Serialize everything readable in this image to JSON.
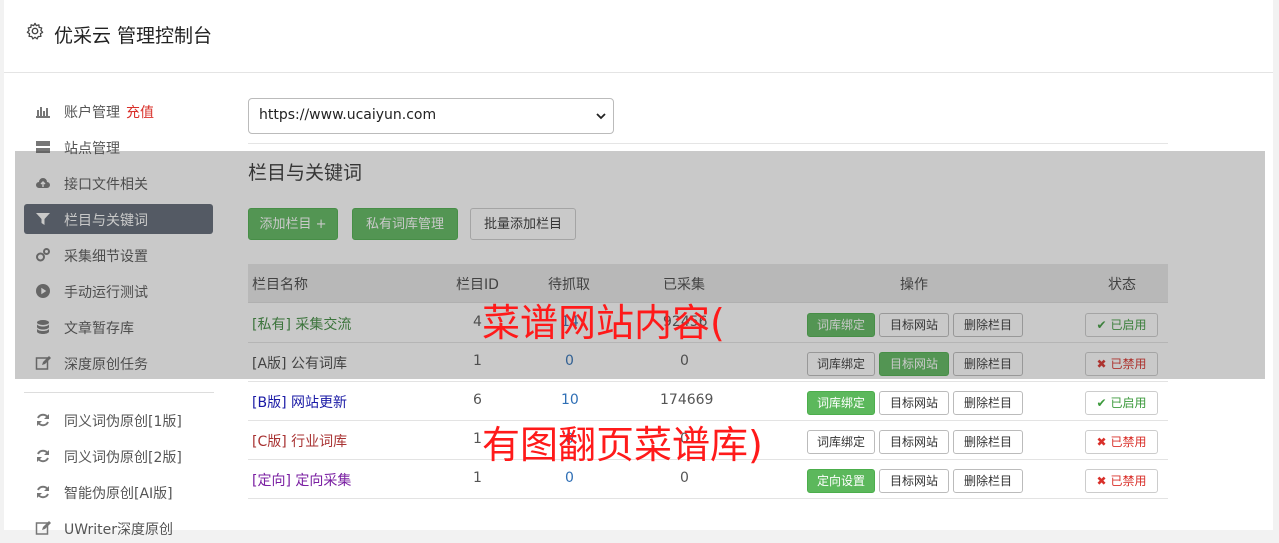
{
  "header": {
    "title": "优采云 管理控制台"
  },
  "sidebar": {
    "items": [
      {
        "label": "账户管理",
        "extra": "充值",
        "icon": "bar-chart-icon"
      },
      {
        "label": "站点管理",
        "icon": "server-icon"
      },
      {
        "label": "接口文件相关",
        "icon": "cloud-upload-icon"
      },
      {
        "label": "栏目与关键词",
        "icon": "filter-icon",
        "active": true
      },
      {
        "label": "采集细节设置",
        "icon": "gears-icon"
      },
      {
        "label": "手动运行测试",
        "icon": "play-circle-icon"
      },
      {
        "label": "文章暂存库",
        "icon": "database-icon"
      },
      {
        "label": "深度原创任务",
        "icon": "edit-icon"
      },
      {
        "label": "同义词伪原创[1版]",
        "icon": "refresh-icon"
      },
      {
        "label": "同义词伪原创[2版]",
        "icon": "refresh-icon"
      },
      {
        "label": "智能伪原创[AI版]",
        "icon": "refresh-icon"
      },
      {
        "label": "UWriter深度原创",
        "icon": "edit-icon"
      }
    ]
  },
  "site_select": {
    "value": "https://www.ucaiyun.com"
  },
  "section": {
    "title": "栏目与关键词"
  },
  "toolbar": {
    "add_column": "添加栏目 +",
    "private_lexicon": "私有词库管理",
    "batch_add": "批量添加栏目"
  },
  "table": {
    "headers": {
      "name": "栏目名称",
      "id": "栏目ID",
      "pending": "待抓取",
      "collected": "已采集",
      "ops": "操作",
      "status": "状态"
    },
    "rows": [
      {
        "tag": "[私有]",
        "name": "采集交流",
        "id": "4",
        "pending": "14",
        "collected": "92456",
        "op1": "词库绑定",
        "op2": "目标网站",
        "op3": "删除栏目",
        "status": "已启用",
        "color": "#3c8a3c"
      },
      {
        "tag": "[A版]",
        "name": "公有词库",
        "id": "1",
        "pending": "0",
        "collected": "0",
        "op1": "词库绑定",
        "op2": "目标网站",
        "op3": "删除栏目",
        "status": "已禁用",
        "color": "#444444"
      },
      {
        "tag": "[B版]",
        "name": "网站更新",
        "id": "6",
        "pending": "10",
        "collected": "174669",
        "op1": "词库绑定",
        "op2": "目标网站",
        "op3": "删除栏目",
        "status": "已启用",
        "color": "#1a1aa6"
      },
      {
        "tag": "[C版]",
        "name": "行业词库",
        "id": "1",
        "pending": "0",
        "collected": "0",
        "op1": "词库绑定",
        "op2": "目标网站",
        "op3": "删除栏目",
        "status": "已禁用",
        "color": "#a83232"
      },
      {
        "tag": "[定向]",
        "name": "定向采集",
        "id": "1",
        "pending": "0",
        "collected": "0",
        "op1": "定向设置",
        "op2": "目标网站",
        "op3": "删除栏目",
        "status": "已禁用",
        "color": "#7a1fa2"
      }
    ]
  },
  "watermark": {
    "line1": "菜谱网站内容(",
    "line2": "有图翻页菜谱库)"
  }
}
